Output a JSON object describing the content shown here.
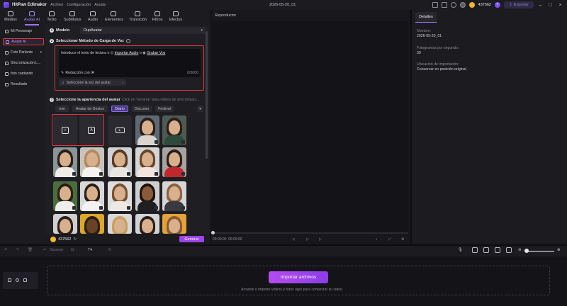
{
  "titlebar": {
    "app_name": "HitPaw Edimakor",
    "menus": [
      "Archivo",
      "Configuración",
      "Ayuda"
    ],
    "doc_title": "2026-05-20_01",
    "credits": "437562",
    "plus": "+",
    "export_label": "Exportar"
  },
  "toolbar": {
    "tools": [
      {
        "label": "Medios",
        "icon": "media-icon"
      },
      {
        "label": "Avatar AI",
        "icon": "avatar-icon"
      },
      {
        "label": "Texto",
        "icon": "text-icon"
      },
      {
        "label": "Subtítulos",
        "icon": "subtitles-icon"
      },
      {
        "label": "Audio",
        "icon": "audio-icon"
      },
      {
        "label": "Elementos",
        "icon": "elements-icon"
      },
      {
        "label": "Transición",
        "icon": "transition-icon"
      },
      {
        "label": "Filtros",
        "icon": "filters-icon"
      },
      {
        "label": "Efectos",
        "icon": "effects-icon"
      }
    ],
    "active_index": 1
  },
  "sidenav": {
    "items": [
      "Mi Personaje",
      "Avatar AI",
      "Foto Parlante",
      "Sincronización L...",
      "foto cantando",
      "Resultado"
    ],
    "active_index": 1
  },
  "panel": {
    "model_label": "Modelo",
    "model_value": "DupAvatar",
    "step2_title": "Seleccionar Método de Carga de Voz",
    "text_prompt": "Introduce el texto de lectura o ",
    "import_audio": "Importar Audio",
    "or_text": " o ",
    "record_voice": "Grabar Voz",
    "ai_writing": "Redacción con IA",
    "char_counter": "0/5000",
    "voice_select": "Seleccione la voz del avatar",
    "step3_title": "Seleccione la apariencia del avatar",
    "step3_hint": "Click en 'Generar' para videos de sincronizaci...",
    "categories": [
      "mio",
      "Avatar de Gestos",
      "Diario",
      "Discurso",
      "Festival"
    ],
    "active_category": 2,
    "footer_credits": "437562",
    "generate_label": "Generar",
    "numbers": [
      "1",
      "2",
      "3"
    ]
  },
  "player": {
    "title": "Reproductor",
    "time": "00:00:00",
    "total": "00:00:00"
  },
  "details": {
    "tab": "Detalles",
    "name_label": "Nombre:",
    "name_value": "2026-05-20_01",
    "fps_label": "Fotogramas por segundo:",
    "fps_value": "30",
    "import_label": "Ubicación de importación:",
    "import_value": "Conservar en posición original"
  },
  "timeline": {
    "split_label": "Separar",
    "import_button": "Importar archivos",
    "drop_hint": "Arrastre o importe videos y fotos aquí para comenzar su video."
  },
  "colors": {
    "accent": "#9b74ff",
    "highlight_red": "#e0393e",
    "generate": "#9c45e8"
  }
}
